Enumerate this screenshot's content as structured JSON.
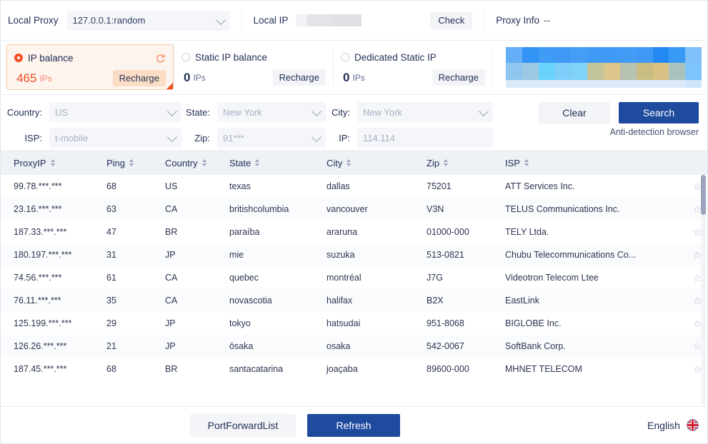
{
  "topbar": {
    "local_proxy_label": "Local Proxy",
    "proxy_value": "127.0.0.1:random",
    "local_ip_label": "Local IP",
    "local_ip_value": "",
    "check_label": "Check",
    "proxy_info_label": "Proxy Info",
    "proxy_info_value": "--"
  },
  "cards": [
    {
      "title": "IP balance",
      "count": "465",
      "unit": "IPs",
      "recharge_label": "Recharge",
      "selected": true,
      "has_refresh": true
    },
    {
      "title": "Static IP balance",
      "count": "0",
      "unit": "IPs",
      "recharge_label": "Recharge",
      "selected": false,
      "has_refresh": false
    },
    {
      "title": "Dedicated Static IP",
      "count": "0",
      "unit": "IPs",
      "recharge_label": "Recharge",
      "selected": false,
      "has_refresh": false
    }
  ],
  "filters": {
    "country_label": "Country:",
    "country_value": "US",
    "state_label": "State:",
    "state_value": "New York",
    "city_label": "City:",
    "city_value": "New York",
    "isp_label": "ISP:",
    "isp_value": "t-mobile",
    "zip_label": "Zip:",
    "zip_value": "91***",
    "ip_label": "IP:",
    "ip_value": "114.114",
    "clear_label": "Clear",
    "search_label": "Search",
    "anti_detection_label": "Anti-detection browser"
  },
  "table": {
    "columns": [
      "ProxyIP",
      "Ping",
      "Country",
      "State",
      "City",
      "Zip",
      "ISP"
    ],
    "rows": [
      {
        "proxyip": "99.78.***.***",
        "ping": "68",
        "country": "US",
        "state": "texas",
        "city": "dallas",
        "zip": "75201",
        "isp": "ATT Services Inc."
      },
      {
        "proxyip": "23.16.***.***",
        "ping": "63",
        "country": "CA",
        "state": "britishcolumbia",
        "city": "vancouver",
        "zip": "V3N",
        "isp": "TELUS Communications Inc."
      },
      {
        "proxyip": "187.33.***.***",
        "ping": "47",
        "country": "BR",
        "state": "paraíba",
        "city": "araruna",
        "zip": "01000-000",
        "isp": "TELY Ltda."
      },
      {
        "proxyip": "180.197.***.***",
        "ping": "31",
        "country": "JP",
        "state": "mie",
        "city": "suzuka",
        "zip": "513-0821",
        "isp": "Chubu Telecommunications Co..."
      },
      {
        "proxyip": "74.56.***.***",
        "ping": "61",
        "country": "CA",
        "state": "quebec",
        "city": "montréal",
        "zip": "J7G",
        "isp": "Videotron Telecom Ltee"
      },
      {
        "proxyip": "76.11.***.***",
        "ping": "35",
        "country": "CA",
        "state": "novascotia",
        "city": "halifax",
        "zip": "B2X",
        "isp": "EastLink"
      },
      {
        "proxyip": "125.199.***.***",
        "ping": "29",
        "country": "JP",
        "state": "tokyo",
        "city": "hatsudai",
        "zip": "951-8068",
        "isp": "BIGLOBE Inc."
      },
      {
        "proxyip": "126.26.***.***",
        "ping": "21",
        "country": "JP",
        "state": "ōsaka",
        "city": "osaka",
        "zip": "542-0067",
        "isp": "SoftBank Corp."
      },
      {
        "proxyip": "187.45.***.***",
        "ping": "68",
        "country": "BR",
        "state": "santacatarina",
        "city": "joaçaba",
        "zip": "89600-000",
        "isp": "MHNET TELECOM"
      }
    ],
    "favorite_icon": "star-icon"
  },
  "footer": {
    "port_forward_label": "PortForwardList",
    "refresh_label": "Refresh",
    "language_label": "English",
    "flag_icon": "uk-flag-icon"
  },
  "colors": {
    "accent_orange": "#f04e23",
    "primary_blue": "#1e4b9e",
    "header_gray": "#eef1f6",
    "field_gray": "#f4f6fa"
  },
  "banner": {
    "row1": [
      "#63aef7",
      "#3394f5",
      "#3f9bf6",
      "#4099f6",
      "#459df6",
      "#3f9bf6",
      "#3f9bf6",
      "#429cf6",
      "#4099f6",
      "#2389f2",
      "#389af4",
      "#7fc0fa"
    ],
    "row2": [
      "#8ec6ef",
      "#9bc8e2",
      "#69d3fb",
      "#7fcdf8",
      "#7fd2f8",
      "#c3c49a",
      "#dcc68c",
      "#b7c2b0",
      "#c9bd81",
      "#d9c083",
      "#a9c2bd",
      "#7cc4fb"
    ],
    "row3": [
      "#dbeaf8",
      "#dbeaf8",
      "#dce9f7",
      "#dce9f7",
      "#dceaf8",
      "#dbe9f7",
      "#dbe9f7",
      "#dbe9f7",
      "#dce9f7",
      "#dbe9f7",
      "#dbe9f7",
      "#cfe5fb"
    ]
  }
}
